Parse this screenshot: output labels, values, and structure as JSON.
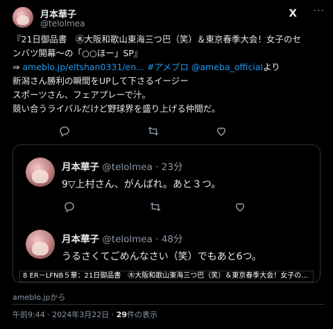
{
  "author": {
    "name": "月本華子",
    "handle": "@telolmea"
  },
  "brand_mark": "X",
  "more_label": "···",
  "tweet": {
    "lines": [
      "『21日御品書　㊍大阪和歌山東海三つ巴（笑）＆東京春季大会！女子のセ",
      "ンバツ開幕～の「○○ほー」SP』"
    ],
    "link_prefix": "⇒ ",
    "link_url": "ameblo.jp/eltshan0331/en...",
    "link_tag": "#アメブロ",
    "link_mention": "@ameba_official",
    "link_suffix": "より",
    "lines2": [
      "新潟さん勝利の瞬間をUPして下さるイージー",
      "スポーツさん、フェアプレーで汁。",
      "競い合うライバルだけど野球界を盛り上げる仲間だ。"
    ]
  },
  "icons": {
    "reply": "reply-icon",
    "retweet": "retweet-icon",
    "like": "heart-icon"
  },
  "quoted": [
    {
      "name": "月本華子",
      "handle": "@telolmea",
      "time": "23分",
      "text": "9▽上村さん、がんばれ。あと３つ。"
    },
    {
      "name": "月本華子",
      "handle": "@telolmea",
      "time": "48分",
      "text": "うるさくてごめんなさい（笑）でもあと6つ。"
    }
  ],
  "caption": "8 ER－LFNB５華：21日御品書　㊍大阪和歌山東海三つ巴（笑）＆東京春季大会！女子の...",
  "source": "ameblo.jpから",
  "meta": {
    "time": "午前9:44",
    "date": "2024年3月22日",
    "views_count": "29",
    "views_label": "件の表示"
  }
}
